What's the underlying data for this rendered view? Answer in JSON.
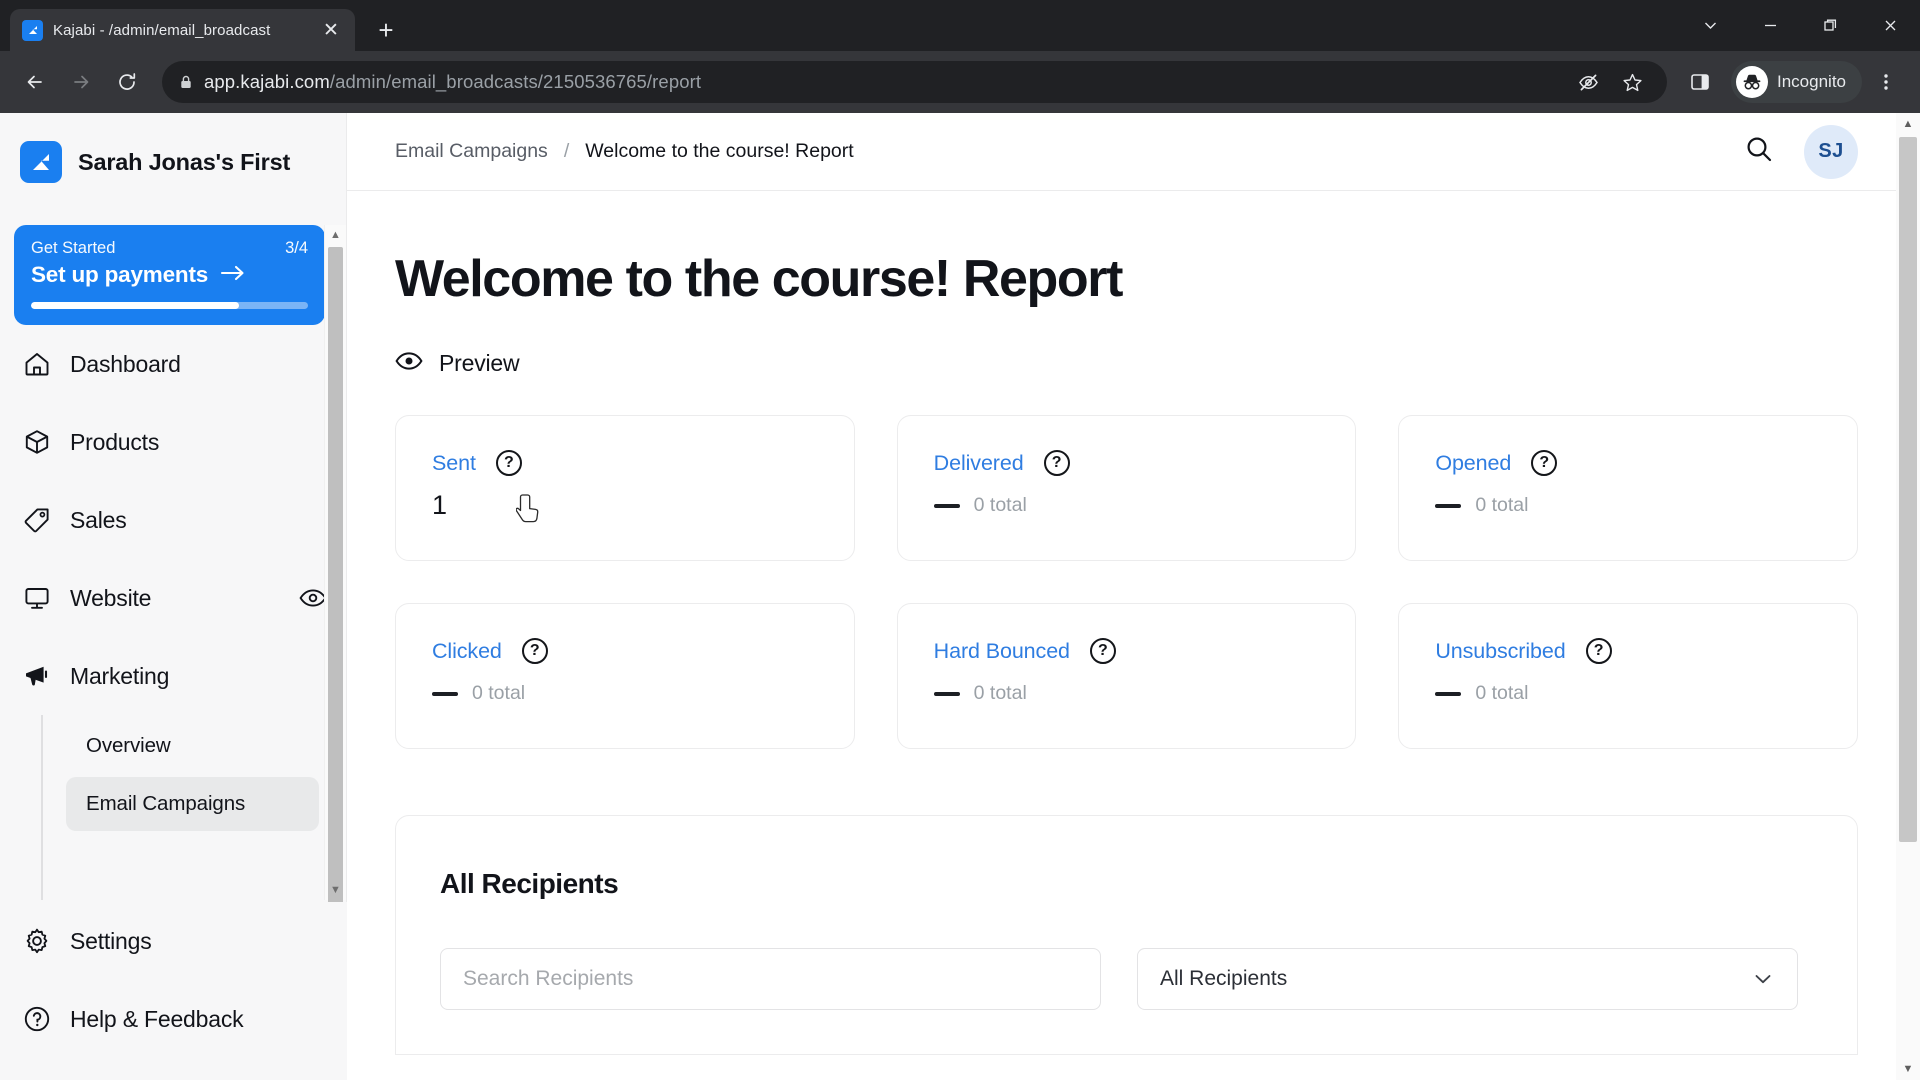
{
  "browser": {
    "tab": {
      "title": "Kajabi - /admin/email_broadcast",
      "close_label": "✕"
    },
    "new_tab_label": "+",
    "window_controls": {
      "chevron": "⌄",
      "minimize": "—",
      "restore": "❐",
      "close": "✕"
    },
    "omnibox": {
      "url_domain": "app.kajabi.com",
      "url_path": "/admin/email_broadcasts/2150536765/report"
    },
    "profile_label": "Incognito"
  },
  "sidebar": {
    "brand": "Sarah Jonas's First",
    "get_started": {
      "label": "Get Started",
      "count": "3/4",
      "cta": "Set up payments",
      "progress_percent": 75
    },
    "items": [
      {
        "label": "Dashboard",
        "icon": "home-icon"
      },
      {
        "label": "Products",
        "icon": "box-icon"
      },
      {
        "label": "Sales",
        "icon": "tag-icon"
      },
      {
        "label": "Website",
        "icon": "monitor-icon",
        "trailing_icon": "eye-icon"
      },
      {
        "label": "Marketing",
        "icon": "megaphone-icon"
      }
    ],
    "marketing_subitems": [
      {
        "label": "Overview",
        "active": false
      },
      {
        "label": "Email Campaigns",
        "active": true
      }
    ],
    "bottom_items": [
      {
        "label": "Settings",
        "icon": "gear-icon"
      },
      {
        "label": "Help & Feedback",
        "icon": "help-circle-icon"
      }
    ]
  },
  "header": {
    "breadcrumb": {
      "parent": "Email Campaigns",
      "separator": "/",
      "current": "Welcome to the course! Report"
    },
    "avatar_initials": "SJ"
  },
  "main": {
    "page_title": "Welcome to the course! Report",
    "preview_label": "Preview",
    "stat_cards": [
      {
        "label": "Sent",
        "value": "1",
        "sub": null,
        "has_value": true
      },
      {
        "label": "Delivered",
        "value": null,
        "sub": "0 total",
        "has_value": false
      },
      {
        "label": "Opened",
        "value": null,
        "sub": "0 total",
        "has_value": false
      },
      {
        "label": "Clicked",
        "value": null,
        "sub": "0 total",
        "has_value": false
      },
      {
        "label": "Hard Bounced",
        "value": null,
        "sub": "0 total",
        "has_value": false
      },
      {
        "label": "Unsubscribed",
        "value": null,
        "sub": "0 total",
        "has_value": false
      }
    ],
    "help_glyph": "?",
    "recipients_panel": {
      "title": "All Recipients",
      "search_placeholder": "Search Recipients",
      "search_value": "",
      "filter_selected": "All Recipients"
    }
  },
  "colors": {
    "brand_blue": "#1a7ff0",
    "link_blue": "#2f7de1",
    "text_dark": "#12141a",
    "muted": "#9aa0a6"
  }
}
